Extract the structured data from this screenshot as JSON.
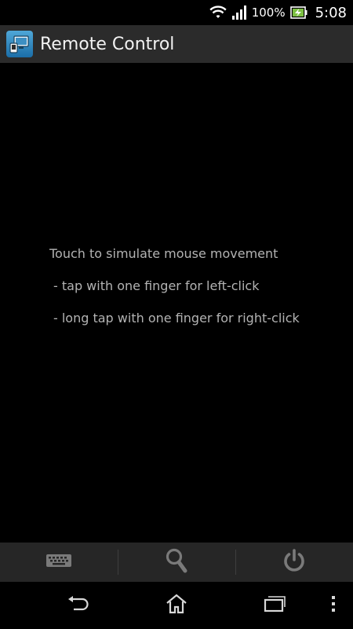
{
  "status_bar": {
    "battery": "100%",
    "time": "5:08",
    "icons": [
      "wifi-icon",
      "signal-icon",
      "battery-charging-icon"
    ]
  },
  "action_bar": {
    "title": "Remote Control",
    "icon": "remote-control-app-icon"
  },
  "touch_area": {
    "instructions": [
      "Touch to simulate mouse movement",
      " - tap with one finger for left-click",
      " - long tap with one finger for right-click"
    ]
  },
  "toolbar": {
    "items": [
      "keyboard-icon",
      "search-icon",
      "power-icon"
    ],
    "icon_color": "#7a7a7a"
  },
  "nav_bar": {
    "items": [
      "back-icon",
      "home-icon",
      "recent-apps-icon",
      "menu-icon"
    ]
  },
  "colors": {
    "action_bar_bg": "#2b2b2b",
    "toolbar_bg": "#262626",
    "instruction_text": "#b3b3b3"
  }
}
